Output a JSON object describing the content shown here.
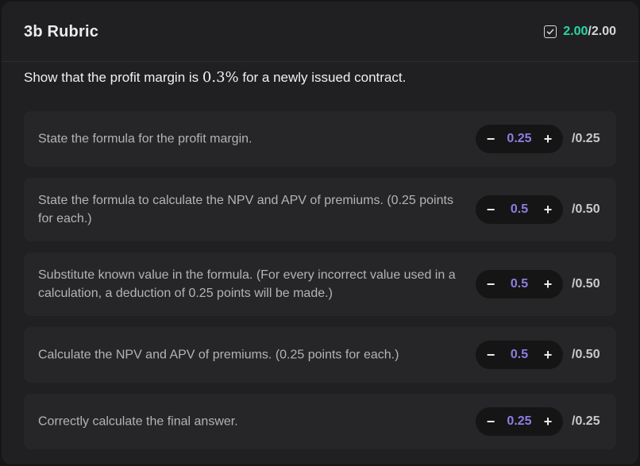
{
  "header": {
    "title": "3b Rubric",
    "score_earned": "2.00",
    "score_total": "/2.00",
    "icon": "checkbox-checked-icon",
    "accent_color": "#2bd6a6"
  },
  "question": {
    "prefix": "Show that the profit margin is ",
    "math": "0.3%",
    "suffix": " for a newly issued contract."
  },
  "items": [
    {
      "text": "State the formula for the profit margin.",
      "value": "0.25",
      "max": "/0.25"
    },
    {
      "text": "State the formula to calculate the NPV and APV of premiums. (0.25 points for each.)",
      "value": "0.5",
      "max": "/0.50"
    },
    {
      "text": "Substitute known value in the formula. (For every incorrect value used in a calculation, a deduction of 0.25 points will be made.)",
      "value": "0.5",
      "max": "/0.50"
    },
    {
      "text": "Calculate the NPV and APV of premiums. (0.25 points for each.)",
      "value": "0.5",
      "max": "/0.50"
    },
    {
      "text": "Correctly calculate the final answer.",
      "value": "0.25",
      "max": "/0.25"
    }
  ],
  "stepper": {
    "minus": "−",
    "plus": "+"
  }
}
